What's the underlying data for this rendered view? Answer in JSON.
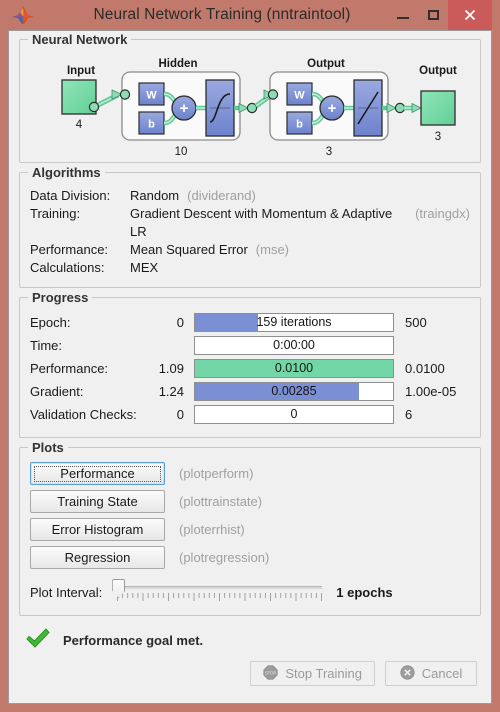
{
  "window": {
    "title": "Neural Network Training (nntraintool)",
    "logo_icon": "matlab-membrane-icon",
    "minimize_label": "–",
    "maximize_label": "□",
    "close_label": "✕",
    "frame_color": "#c0796b",
    "close_button_color": "#cb5a5a"
  },
  "neural_network": {
    "title": "Neural Network",
    "input_label": "Input",
    "input_size": "4",
    "hidden_label": "Hidden",
    "hidden_size": "10",
    "hidden_weight_label": "W",
    "hidden_bias_label": "b",
    "hidden_sum_label": "+",
    "hidden_transfer_icon": "sigmoid-transfer-icon",
    "output_layer_label": "Output",
    "output_layer_size": "3",
    "output_weight_label": "W",
    "output_bias_label": "b",
    "output_sum_label": "+",
    "output_transfer_icon": "linear-transfer-icon",
    "output_label": "Output",
    "output_size": "3",
    "block_color": "#7b8fd4",
    "terminal_color": "#7ddfaf"
  },
  "algorithms": {
    "title": "Algorithms",
    "rows": [
      {
        "label": "Data Division:",
        "value": "Random",
        "fn": "(dividerand)"
      },
      {
        "label": "Training:",
        "value": "Gradient Descent with Momentum & Adaptive LR",
        "fn": "(traingdx)"
      },
      {
        "label": "Performance:",
        "value": "Mean Squared Error",
        "fn": "(mse)"
      },
      {
        "label": "Calculations:",
        "value": "MEX",
        "fn": ""
      }
    ]
  },
  "progress": {
    "title": "Progress",
    "rows": [
      {
        "label": "Epoch:",
        "start": "0",
        "bar_text": "159 iterations",
        "end": "500",
        "fill_percent": 32,
        "fill_color": "#7b8fd4"
      },
      {
        "label": "Time:",
        "start": "",
        "bar_text": "0:00:00",
        "end": "",
        "fill_percent": 0,
        "fill_color": "#7b8fd4"
      },
      {
        "label": "Performance:",
        "start": "1.09",
        "bar_text": "0.0100",
        "end": "0.0100",
        "fill_percent": 100,
        "fill_color": "#72d6a6"
      },
      {
        "label": "Gradient:",
        "start": "1.24",
        "bar_text": "0.00285",
        "end": "1.00e-05",
        "fill_percent": 83,
        "fill_color": "#7b8fd4"
      },
      {
        "label": "Validation Checks:",
        "start": "0",
        "bar_text": "0",
        "end": "6",
        "fill_percent": 0,
        "fill_color": "#7b8fd4"
      }
    ]
  },
  "plots": {
    "title": "Plots",
    "buttons": [
      {
        "label": "Performance",
        "fn": "(plotperform)",
        "focused": true
      },
      {
        "label": "Training State",
        "fn": "(plottrainstate)",
        "focused": false
      },
      {
        "label": "Error Histogram",
        "fn": "(ploterrhist)",
        "focused": false
      },
      {
        "label": "Regression",
        "fn": "(plotregression)",
        "focused": false
      }
    ],
    "interval_label": "Plot Interval:",
    "interval_value": "1 epochs",
    "interval_position_percent": 0
  },
  "status": {
    "icon": "green-check-icon",
    "text": "Performance goal met."
  },
  "footer": {
    "stop_training_label": "Stop Training",
    "stop_training_icon": "stop-sign-icon",
    "cancel_label": "Cancel",
    "cancel_icon": "circle-x-icon"
  }
}
